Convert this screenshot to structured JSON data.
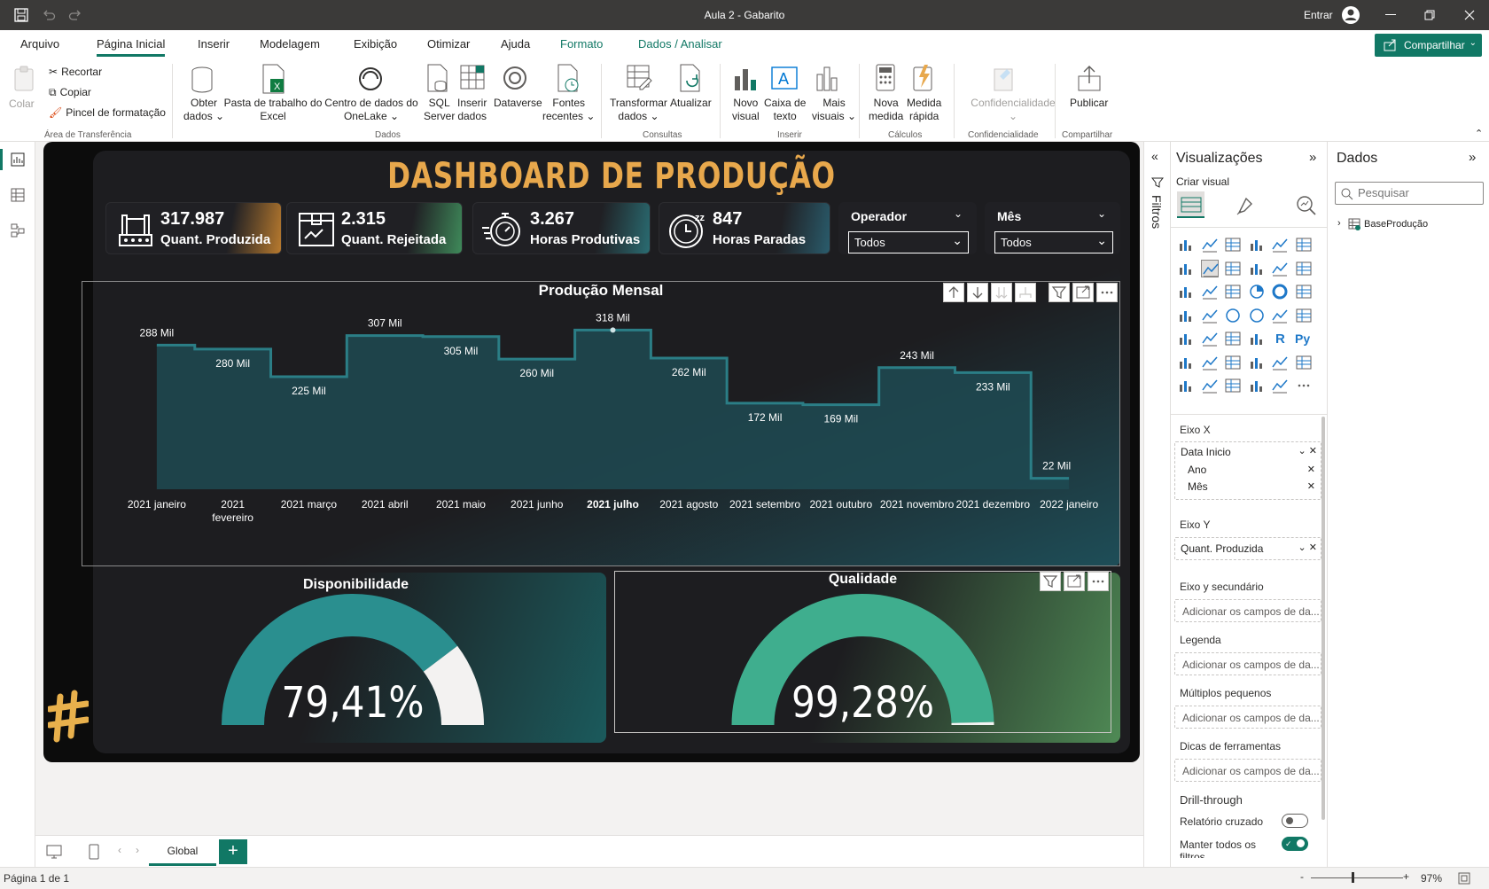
{
  "window": {
    "title": "Aula 2 - Gabarito",
    "signin": "Entrar"
  },
  "menu": {
    "tabs": [
      "Arquivo",
      "Página Inicial",
      "Inserir",
      "Modelagem",
      "Exibição",
      "Otimizar",
      "Ajuda",
      "Formato",
      "Dados / Analisar"
    ],
    "active": "Página Inicial",
    "share": "Compartilhar"
  },
  "ribbon": {
    "clipboard": {
      "paste": "Colar",
      "cut": "Recortar",
      "copy": "Copiar",
      "format_painter": "Pincel de formatação",
      "group": "Área de Transferência"
    },
    "data": {
      "get_data": [
        "Obter",
        "dados"
      ],
      "excel": [
        "Pasta de trabalho do",
        "Excel"
      ],
      "onelake": [
        "Centro de dados do",
        "OneLake"
      ],
      "sql": [
        "SQL",
        "Server"
      ],
      "enter": [
        "Inserir",
        "dados"
      ],
      "dataverse": "Dataverse",
      "recent": [
        "Fontes",
        "recentes"
      ],
      "group": "Dados"
    },
    "queries": {
      "transform": [
        "Transformar",
        "dados"
      ],
      "refresh": "Atualizar",
      "group": "Consultas"
    },
    "insert": {
      "new_visual": [
        "Novo",
        "visual"
      ],
      "textbox": [
        "Caixa de",
        "texto"
      ],
      "more": [
        "Mais",
        "visuais"
      ],
      "group": "Inserir"
    },
    "calc": {
      "measure": [
        "Nova",
        "medida"
      ],
      "quick": [
        "Medida",
        "rápida"
      ],
      "group": "Cálculos"
    },
    "sens": {
      "label": "Confidencialidade",
      "group": "Confidencialidade"
    },
    "share": {
      "publish": "Publicar",
      "group": "Compartilhar"
    }
  },
  "dashboard": {
    "title": "DASHBOARD DE PRODUÇÃO",
    "kpis": [
      {
        "value": "317.987",
        "label": "Quant. Produzida",
        "icon": "factory-icon"
      },
      {
        "value": "2.315",
        "label": "Quant. Rejeitada",
        "icon": "box-icon"
      },
      {
        "value": "3.267",
        "label": "Horas Produtivas",
        "icon": "stopwatch-icon"
      },
      {
        "value": "847",
        "label": "Horas Paradas",
        "icon": "sleep-clock-icon"
      }
    ],
    "slicers": [
      {
        "title": "Operador",
        "value": "Todos"
      },
      {
        "title": "Mês",
        "value": "Todos"
      }
    ],
    "gauges": [
      {
        "title": "Disponibilidade",
        "value": "79,41%",
        "fraction": 0.7941,
        "color": "#2a8f8f"
      },
      {
        "title": "Qualidade",
        "value": "99,28%",
        "fraction": 0.9928,
        "color": "#3fae8e"
      }
    ]
  },
  "chart_data": {
    "type": "area",
    "title": "Produção Mensal",
    "categories": [
      "2021 janeiro",
      "2021 fevereiro",
      "2021 março",
      "2021 abril",
      "2021 maio",
      "2021 junho",
      "2021 julho",
      "2021 agosto",
      "2021 setembro",
      "2021 outubro",
      "2021 novembro",
      "2021 dezembro",
      "2022 janeiro"
    ],
    "values": [
      288000,
      280000,
      225000,
      307000,
      305000,
      260000,
      318000,
      262000,
      172000,
      169000,
      243000,
      233000,
      22000
    ],
    "labels": [
      "288 Mil",
      "280 Mil",
      "225 Mil",
      "307 Mil",
      "305 Mil",
      "260 Mil",
      "318 Mil",
      "262 Mil",
      "172 Mil",
      "169 Mil",
      "243 Mil",
      "233 Mil",
      "22 Mil"
    ],
    "highlight": "2021 julho",
    "ylim": [
      0,
      340000
    ],
    "line_color": "#2b7e86",
    "fill_color": "#1f4a52"
  },
  "filters": {
    "label": "Filtros"
  },
  "viz_pane": {
    "title": "Visualizações",
    "build": "Criar visual",
    "x_axis": {
      "label": "Eixo X",
      "field": "Data Inicio",
      "children": [
        "Ano",
        "Mês"
      ]
    },
    "y_axis": {
      "label": "Eixo Y",
      "field": "Quant. Produzida"
    },
    "wells": [
      {
        "label": "Eixo y secundário",
        "placeholder": "Adicionar os campos de da..."
      },
      {
        "label": "Legenda",
        "placeholder": "Adicionar os campos de da..."
      },
      {
        "label": "Múltiplos pequenos",
        "placeholder": "Adicionar os campos de da..."
      },
      {
        "label": "Dicas de ferramentas",
        "placeholder": "Adicionar os campos de da..."
      }
    ],
    "drill": "Drill-through",
    "cross_report": "Relatório cruzado",
    "keep_filters": "Manter todos os filtros"
  },
  "data_pane": {
    "title": "Dados",
    "search": "Pesquisar",
    "table": "BaseProdução"
  },
  "pages": {
    "tabs": [
      "Global"
    ]
  },
  "status": {
    "page": "Página 1 de 1",
    "zoom": "97%"
  }
}
